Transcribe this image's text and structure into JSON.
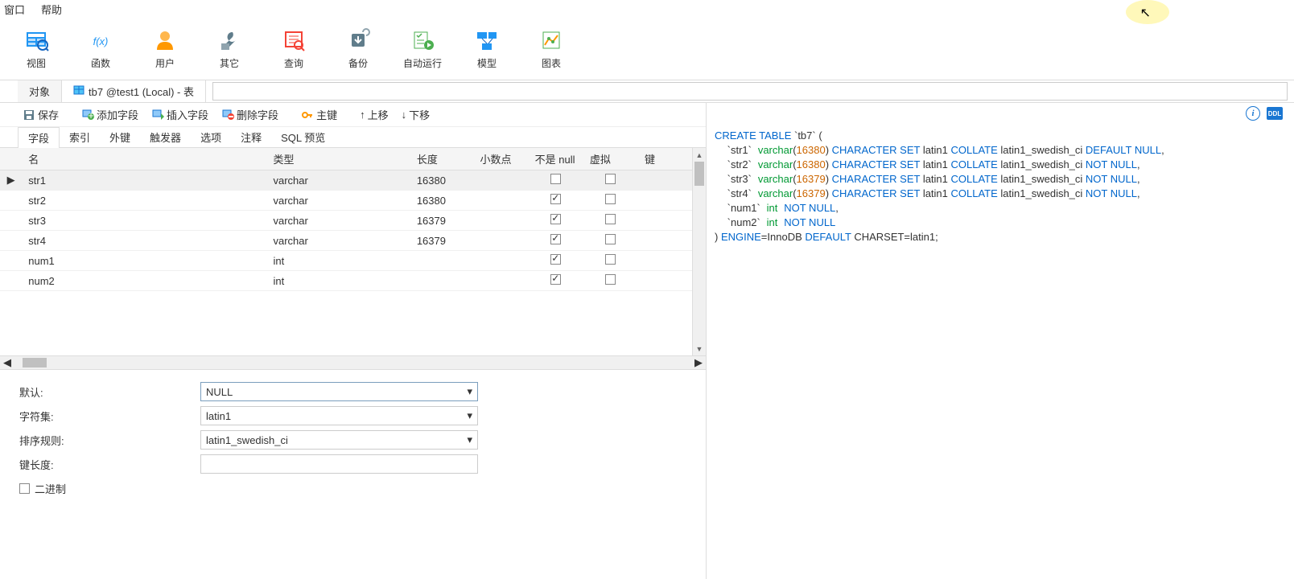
{
  "menu": {
    "window": "窗口",
    "help": "帮助"
  },
  "toolbar": [
    {
      "id": "view",
      "label": "视图",
      "color": "#2196f3",
      "icon": "view"
    },
    {
      "id": "function",
      "label": "函数",
      "color": "#2196f3",
      "icon": "fx"
    },
    {
      "id": "user",
      "label": "用户",
      "color": "#ff9800",
      "icon": "user"
    },
    {
      "id": "other",
      "label": "其它",
      "color": "#607d8b",
      "icon": "wrench"
    },
    {
      "id": "query",
      "label": "查询",
      "color": "#f44336",
      "icon": "query"
    },
    {
      "id": "backup",
      "label": "备份",
      "color": "#607d8b",
      "icon": "backup"
    },
    {
      "id": "autorun",
      "label": "自动运行",
      "color": "#4caf50",
      "icon": "autorun"
    },
    {
      "id": "model",
      "label": "模型",
      "color": "#2196f3",
      "icon": "model"
    },
    {
      "id": "chart",
      "label": "图表",
      "color": "#4caf50",
      "icon": "chart"
    }
  ],
  "tabs": {
    "objects": "对象",
    "active_tab": "tb7 @test1 (Local) - 表"
  },
  "actions": {
    "save": "保存",
    "add_field": "添加字段",
    "insert_field": "插入字段",
    "delete_field": "删除字段",
    "primary_key": "主键",
    "move_up": "上移",
    "move_down": "下移"
  },
  "sub_tabs": [
    "字段",
    "索引",
    "外键",
    "触发器",
    "选项",
    "注释",
    "SQL 预览"
  ],
  "grid": {
    "headers": {
      "name": "名",
      "type": "类型",
      "length": "长度",
      "decimals": "小数点",
      "not_null": "不是 null",
      "virtual": "虚拟",
      "key": "键"
    },
    "rows": [
      {
        "name": "str1",
        "type": "varchar",
        "length": "16380",
        "decimals": "",
        "not_null": false,
        "virtual": false,
        "selected": true
      },
      {
        "name": "str2",
        "type": "varchar",
        "length": "16380",
        "decimals": "",
        "not_null": true,
        "virtual": false
      },
      {
        "name": "str3",
        "type": "varchar",
        "length": "16379",
        "decimals": "",
        "not_null": true,
        "virtual": false
      },
      {
        "name": "str4",
        "type": "varchar",
        "length": "16379",
        "decimals": "",
        "not_null": true,
        "virtual": false
      },
      {
        "name": "num1",
        "type": "int",
        "length": "",
        "decimals": "",
        "not_null": true,
        "virtual": false
      },
      {
        "name": "num2",
        "type": "int",
        "length": "",
        "decimals": "",
        "not_null": true,
        "virtual": false
      }
    ]
  },
  "props": {
    "default_label": "默认:",
    "default_value": "NULL",
    "charset_label": "字符集:",
    "charset_value": "latin1",
    "collation_label": "排序规则:",
    "collation_value": "latin1_swedish_ci",
    "keylen_label": "键长度:",
    "keylen_value": "",
    "binary_label": "二进制"
  },
  "right_icons": {
    "info": "i",
    "ddl": "DDL"
  },
  "sql": {
    "line1_a": "CREATE TABLE",
    "line1_b": " `tb7` (",
    "cols": [
      {
        "name": "str1",
        "type": "varchar",
        "len": "16380",
        "tail_a": " CHARACTER SET",
        "tail_b": " latin1 ",
        "tail_c": "COLLATE",
        "tail_d": " latin1_swedish_ci ",
        "null": "DEFAULT NULL",
        "comma": ","
      },
      {
        "name": "str2",
        "type": "varchar",
        "len": "16380",
        "tail_a": " CHARACTER SET",
        "tail_b": " latin1 ",
        "tail_c": "COLLATE",
        "tail_d": " latin1_swedish_ci ",
        "null": "NOT NULL",
        "comma": ","
      },
      {
        "name": "str3",
        "type": "varchar",
        "len": "16379",
        "tail_a": " CHARACTER SET",
        "tail_b": " latin1 ",
        "tail_c": "COLLATE",
        "tail_d": " latin1_swedish_ci ",
        "null": "NOT NULL",
        "comma": ","
      },
      {
        "name": "str4",
        "type": "varchar",
        "len": "16379",
        "tail_a": " CHARACTER SET",
        "tail_b": " latin1 ",
        "tail_c": "COLLATE",
        "tail_d": " latin1_swedish_ci ",
        "null": "NOT NULL",
        "comma": ","
      }
    ],
    "intcols": [
      {
        "name": "num1",
        "type": "int",
        "null": "NOT NULL",
        "comma": ","
      },
      {
        "name": "num2",
        "type": "int",
        "null": "NOT NULL",
        "comma": ""
      }
    ],
    "close_a": ") ",
    "close_b": "ENGINE",
    "close_c": "=InnoDB ",
    "close_d": "DEFAULT",
    "close_e": " CHARSET=latin1;"
  }
}
